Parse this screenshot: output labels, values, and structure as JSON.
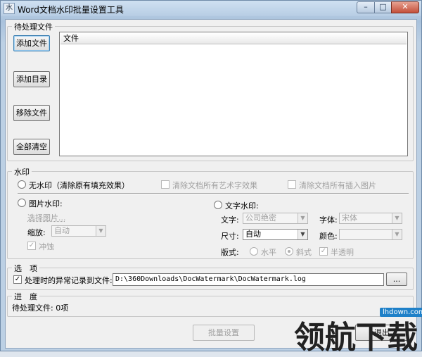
{
  "window": {
    "title": "Word文档水印批量设置工具",
    "icon": "app-icon"
  },
  "files_group": {
    "label": "待处理文件",
    "buttons": {
      "add_file": "添加文件",
      "add_dir": "添加目录",
      "remove_file": "移除文件",
      "clear_all": "全部清空"
    },
    "list_header": "文件"
  },
  "watermark_group": {
    "label": "水印",
    "no_watermark": "无水印（清除原有填充效果）",
    "clear_art_text": "清除文档所有艺术字效果",
    "clear_inserted_images": "清除文档所有插入图片",
    "image_watermark": "图片水印:",
    "select_image": "选择图片...",
    "scale_label": "缩放:",
    "scale_value": "自动",
    "washout": "冲蚀",
    "text_watermark": "文字水印:",
    "text_label": "文字:",
    "text_value": "公司绝密",
    "font_label": "字体:",
    "font_value": "宋体",
    "size_label": "尺寸:",
    "size_value": "自动",
    "color_label": "颜色:",
    "layout_label": "版式:",
    "horizontal": "水平",
    "diagonal": "斜式",
    "semitransparent": "半透明"
  },
  "options_group": {
    "label": "选　项",
    "log_errors": "处理时的异常记录到文件:",
    "log_path": "D:\\360Downloads\\DocWatermark\\DocWatermark.log",
    "browse": "..."
  },
  "progress_group": {
    "label": "进　度",
    "pending": "待处理文件: 0项"
  },
  "footer": {
    "batch_button": "批量设置",
    "exit_button": "退出"
  },
  "overlay": {
    "logo_text": "领航下载",
    "logo_url": "lhdown.com"
  }
}
